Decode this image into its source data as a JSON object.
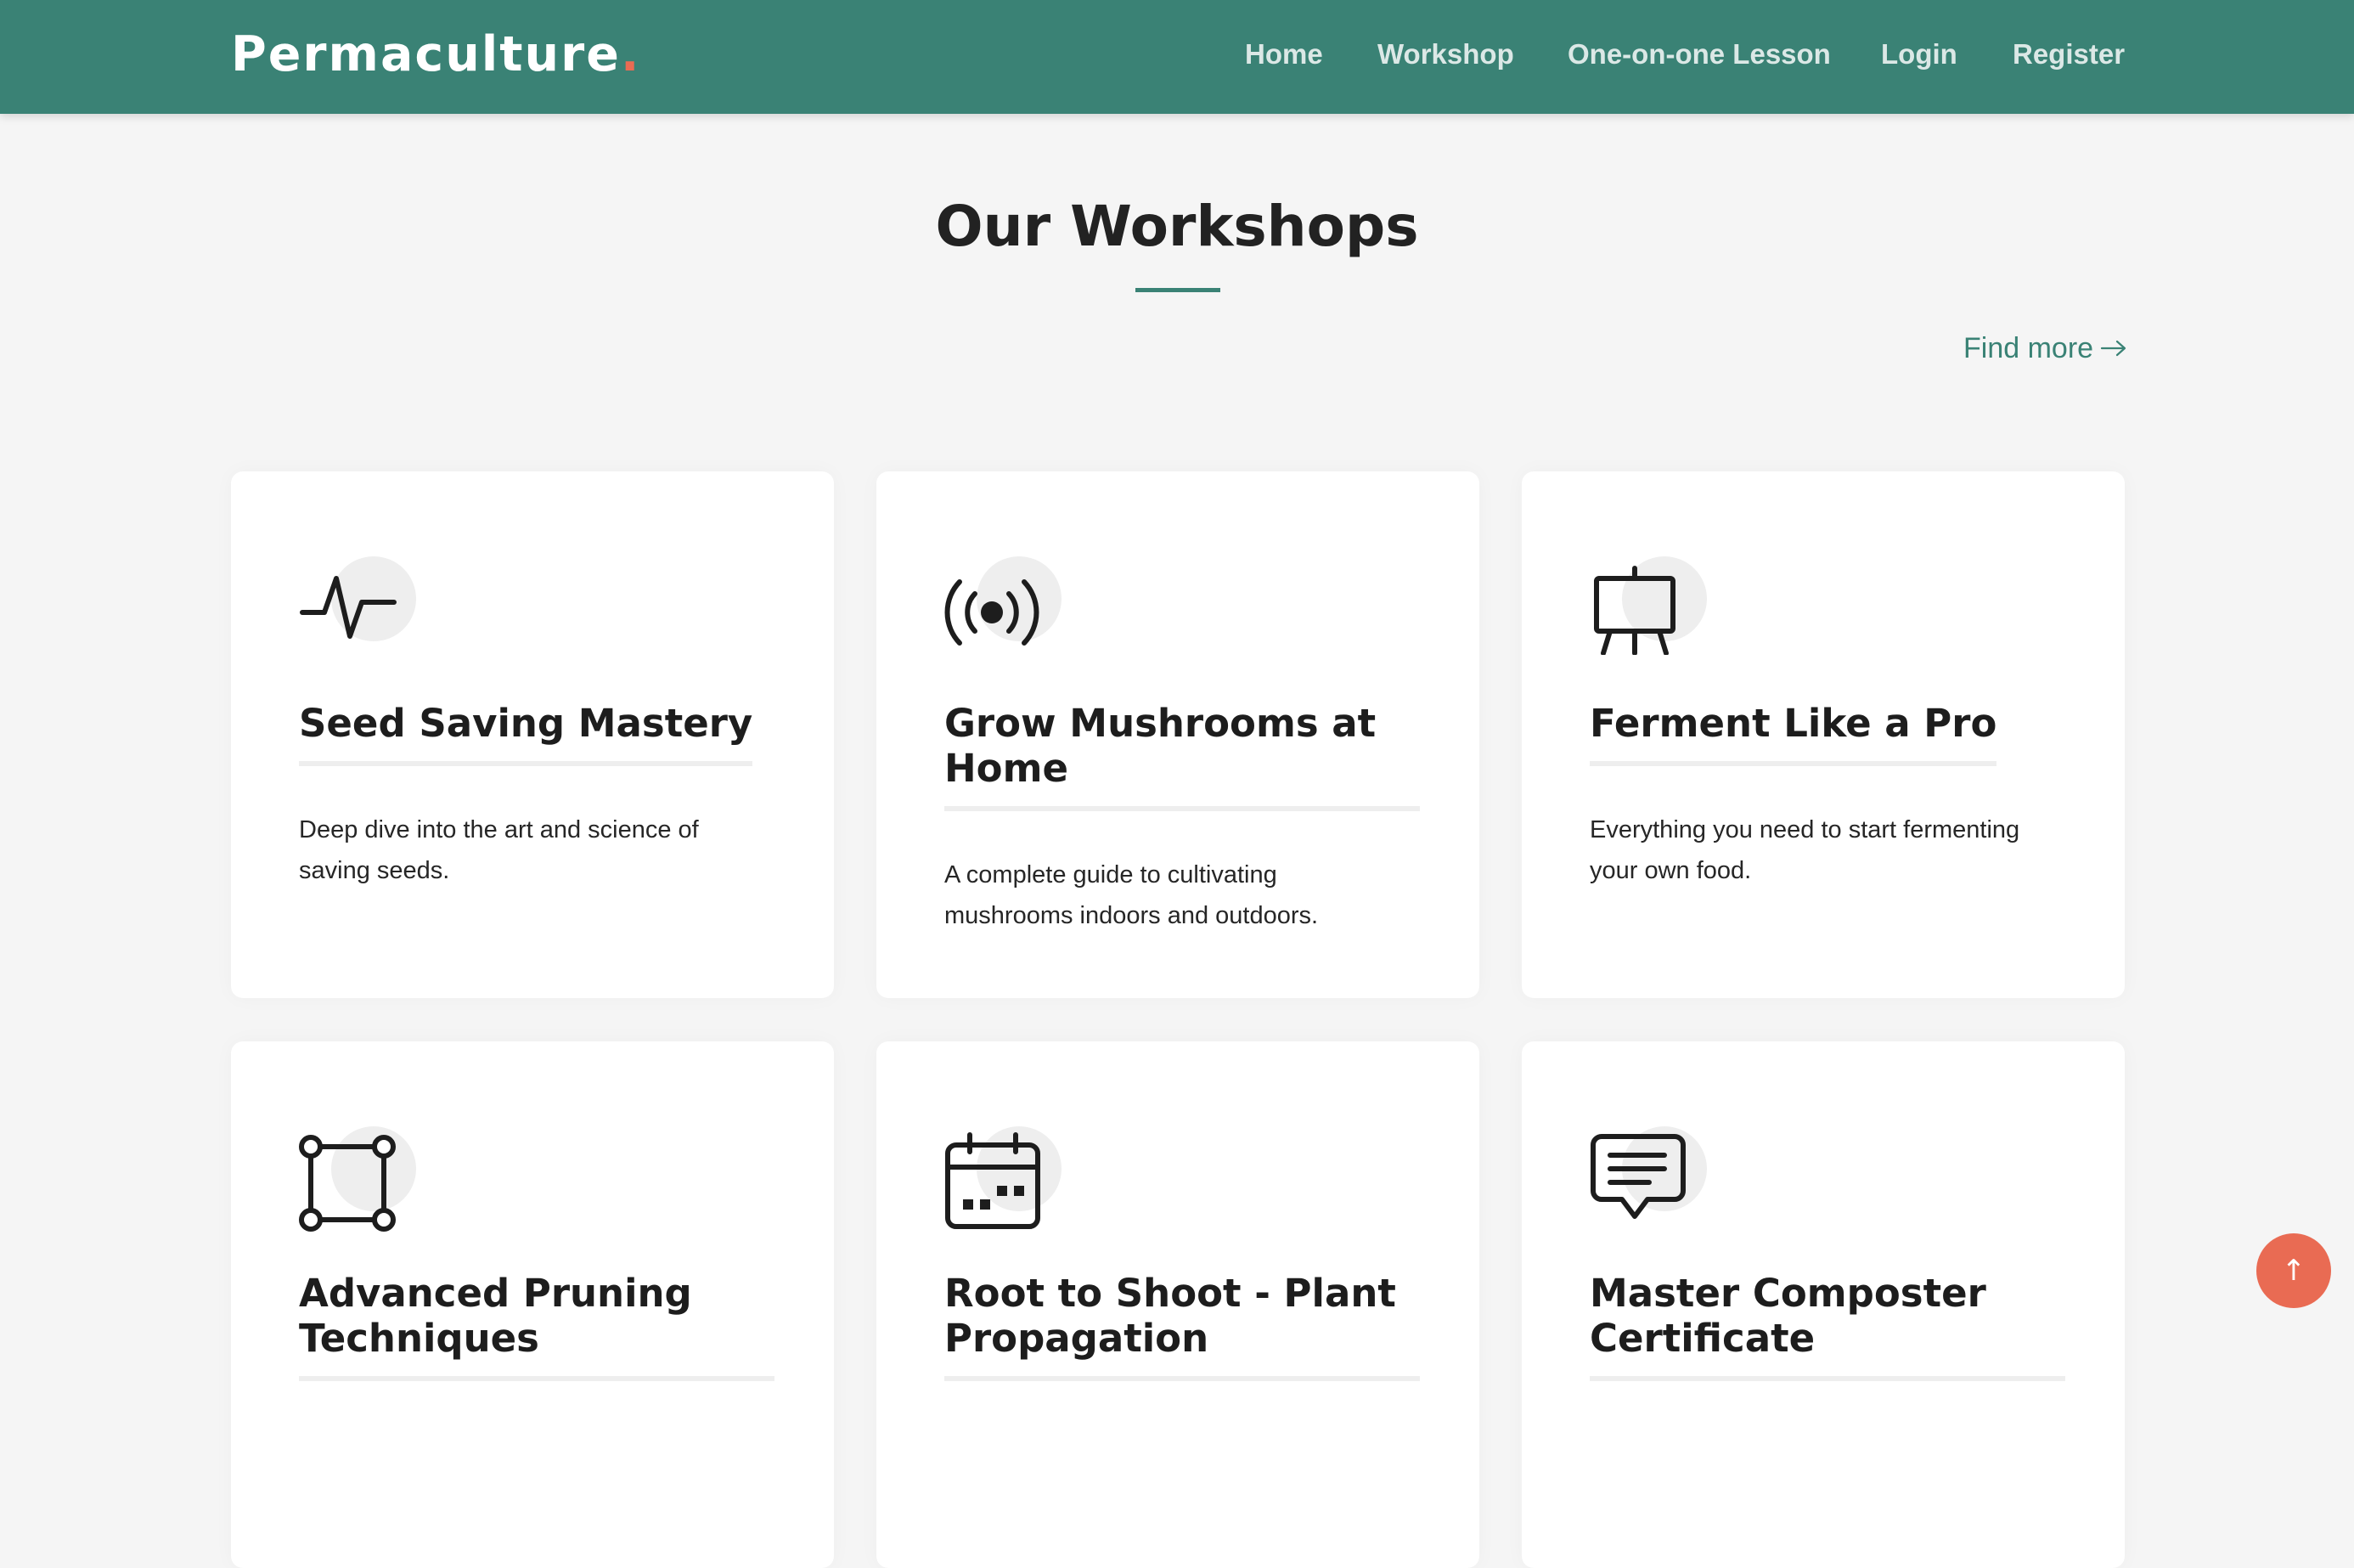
{
  "colors": {
    "nav_bg": "#3a8275",
    "accent": "#3a8275",
    "brand_dot": "#e96b53",
    "back_to_top_bg": "#e96b53",
    "page_bg": "#f5f5f5",
    "card_bg": "#ffffff"
  },
  "navbar": {
    "brand": "Permaculture",
    "brand_dot": ".",
    "links": [
      {
        "label": "Home"
      },
      {
        "label": "Workshop"
      },
      {
        "label": "One-on-one Lesson"
      },
      {
        "label": "Login"
      },
      {
        "label": "Register"
      }
    ]
  },
  "section": {
    "title": "Our Workshops",
    "find_more": "Find more",
    "find_more_icon": "arrow-right-icon"
  },
  "workshops": [
    {
      "title": "Seed Saving Mastery",
      "description": "Deep dive into the art and science of saving seeds.",
      "icon": "activity-pulse-icon"
    },
    {
      "title": "Grow Mushrooms at Home",
      "description": "A complete guide to cultivating mushrooms indoors and outdoors.",
      "icon": "broadcast-icon"
    },
    {
      "title": "Ferment Like a Pro",
      "description": "Everything you need to start fermenting your own food.",
      "icon": "easel-icon"
    },
    {
      "title": "Advanced Pruning Techniques",
      "description": "",
      "icon": "bounding-box-icon"
    },
    {
      "title": "Root to Shoot - Plant Propagation",
      "description": "",
      "icon": "calendar-icon"
    },
    {
      "title": "Master Composter Certificate",
      "description": "",
      "icon": "chat-message-icon"
    }
  ],
  "back_to_top": {
    "icon": "arrow-up-icon",
    "glyph": "↑"
  }
}
